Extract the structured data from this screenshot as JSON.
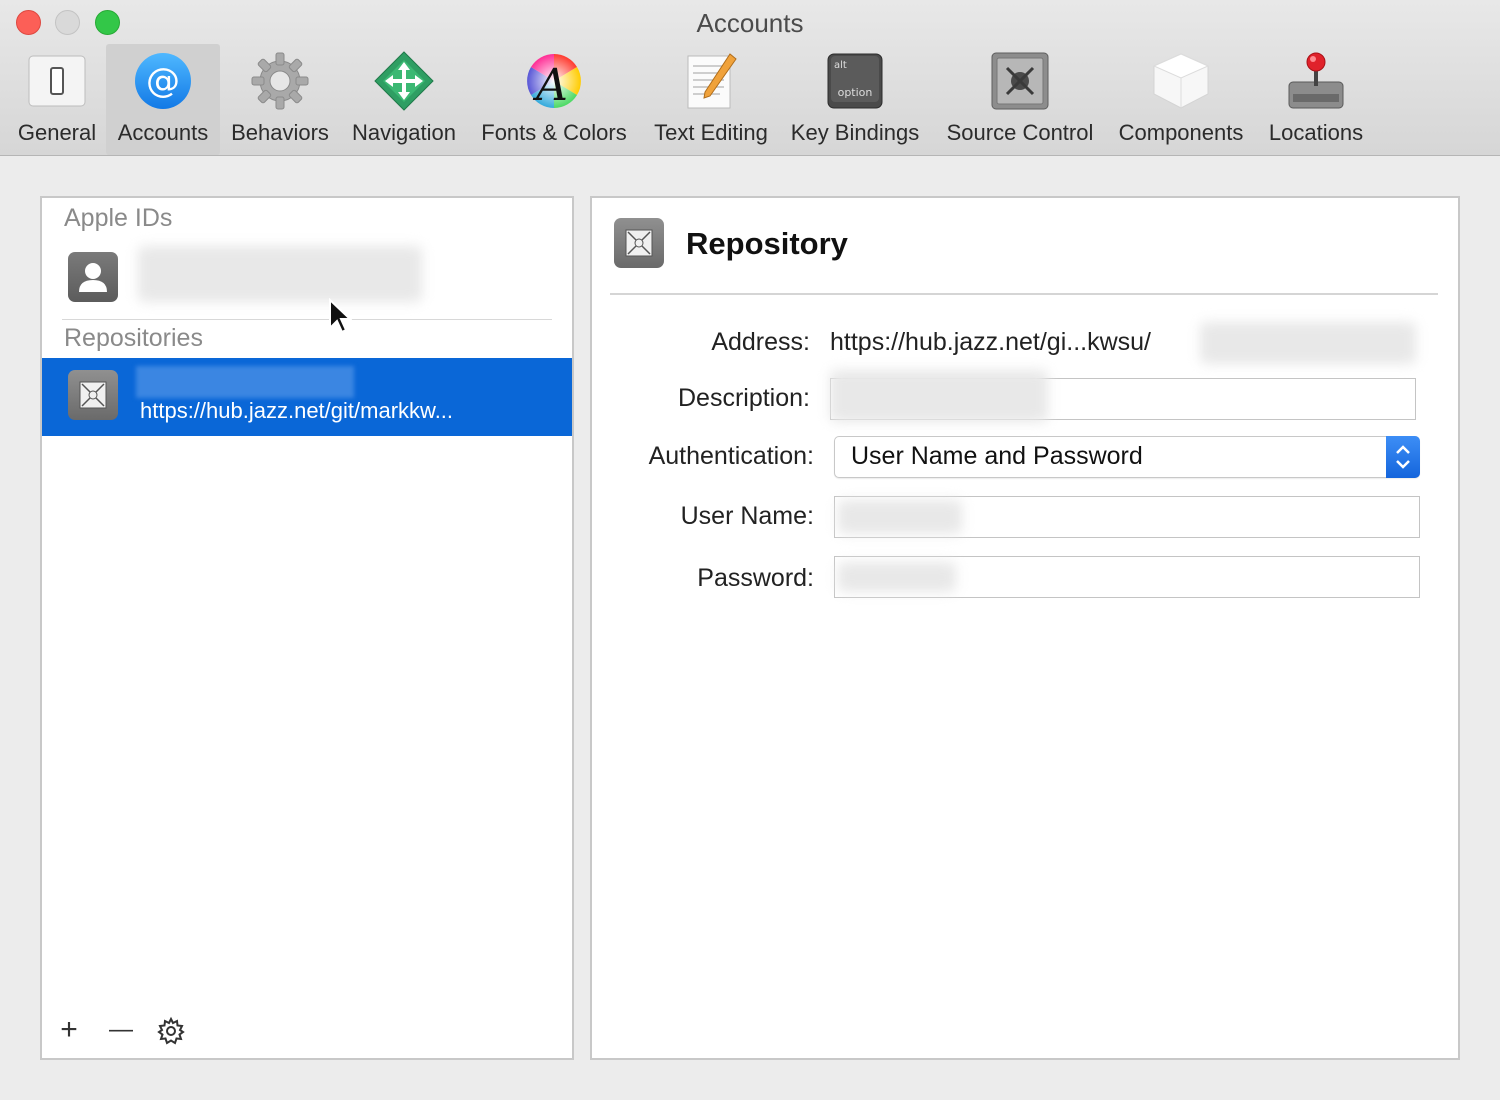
{
  "window": {
    "title": "Accounts"
  },
  "toolbar": {
    "items": [
      {
        "label": "General",
        "icon": "general-icon"
      },
      {
        "label": "Accounts",
        "icon": "at-sign-icon"
      },
      {
        "label": "Behaviors",
        "icon": "gear-icon"
      },
      {
        "label": "Navigation",
        "icon": "navigation-arrows-icon"
      },
      {
        "label": "Fonts & Colors",
        "icon": "font-color-wheel-icon"
      },
      {
        "label": "Text Editing",
        "icon": "notepad-pencil-icon"
      },
      {
        "label": "Key Bindings",
        "icon": "option-key-icon"
      },
      {
        "label": "Source Control",
        "icon": "safe-icon"
      },
      {
        "label": "Components",
        "icon": "component-box-icon"
      },
      {
        "label": "Locations",
        "icon": "joystick-drive-icon"
      }
    ],
    "active": "Accounts",
    "key_top_label": "alt",
    "key_bottom_label": "option"
  },
  "left_panel": {
    "apple_ids_heading": "Apple IDs",
    "repositories_heading": "Repositories",
    "repository_url": "https://hub.jazz.net/git/markkw...",
    "add_label": "+",
    "remove_label": "—"
  },
  "detail": {
    "title": "Repository",
    "address_label": "Address:",
    "address_value": "https://hub.jazz.net/gi...kwsu/",
    "description_label": "Description:",
    "authentication_label": "Authentication:",
    "authentication_value": "User Name and Password",
    "username_label": "User Name:",
    "password_label": "Password:"
  },
  "colors": {
    "selection": "#0a67d7",
    "accent": "#1d72e8"
  }
}
